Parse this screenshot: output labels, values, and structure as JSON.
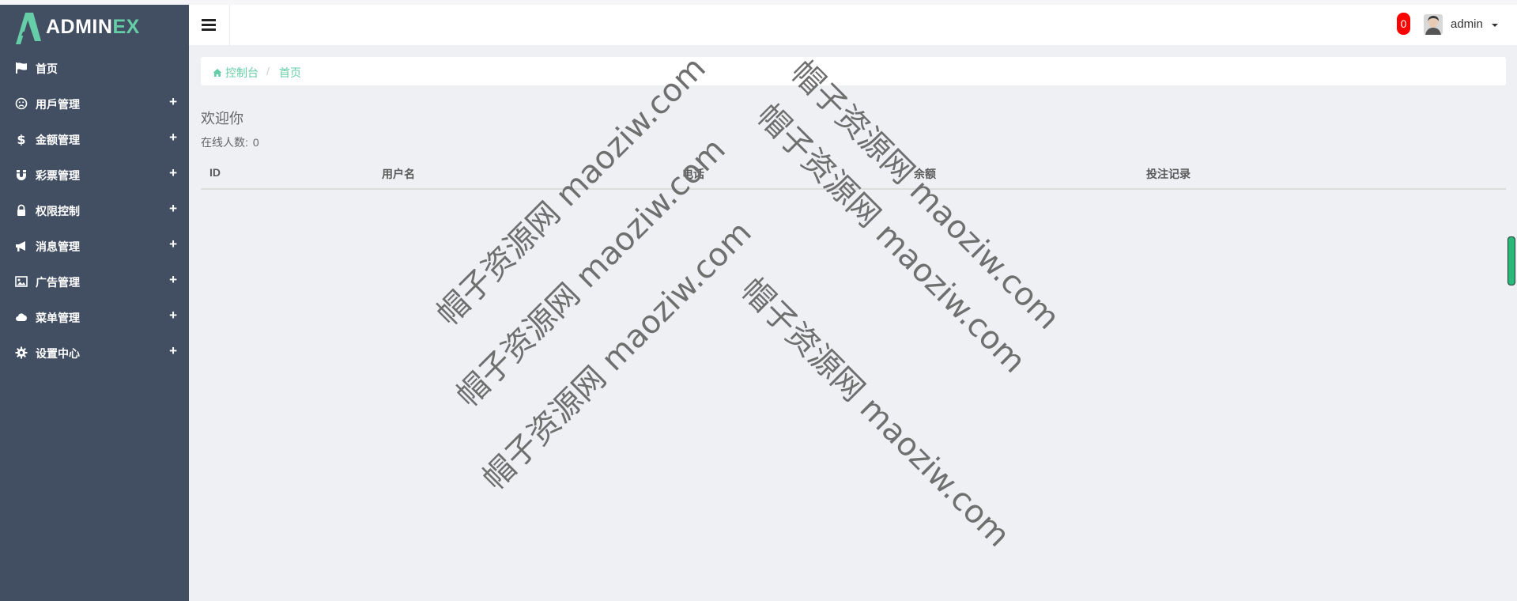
{
  "brand": {
    "logo_main": "ADMIN",
    "logo_accent": "EX",
    "accent_color": "#65cea7",
    "sidebar_bg": "#424f63"
  },
  "sidebar": {
    "items": [
      {
        "icon": "flag-icon",
        "label": "首页",
        "expandable": false
      },
      {
        "icon": "frown-icon",
        "label": "用戶管理",
        "expandable": true,
        "expander": "+"
      },
      {
        "icon": "dollar-icon",
        "label": "金额管理",
        "expandable": true,
        "expander": "+"
      },
      {
        "icon": "magnet-icon",
        "label": "彩票管理",
        "expandable": true,
        "expander": "+"
      },
      {
        "icon": "lock-icon",
        "label": "权限控制",
        "expandable": true,
        "expander": "+"
      },
      {
        "icon": "bullhorn-icon",
        "label": "消息管理",
        "expandable": true,
        "expander": "+"
      },
      {
        "icon": "image-icon",
        "label": "广告管理",
        "expandable": true,
        "expander": "+"
      },
      {
        "icon": "cloud-icon",
        "label": "菜单管理",
        "expandable": true,
        "expander": "+"
      },
      {
        "icon": "gear-icon",
        "label": "设置中心",
        "expandable": true,
        "expander": "+"
      }
    ]
  },
  "header": {
    "notification_count": "0",
    "notification_color": "#ff0000",
    "username": "admin"
  },
  "breadcrumb": {
    "home": "控制台",
    "separator": "/",
    "current": "首页"
  },
  "main": {
    "welcome": "欢迎你",
    "online_label": "在线人数:",
    "online_count": "0",
    "table": {
      "columns": [
        "ID",
        "用户名",
        "电话",
        "余额",
        "投注记录"
      ],
      "rows": []
    }
  },
  "watermark": {
    "text": "帽子资源网 maoziw.com"
  }
}
